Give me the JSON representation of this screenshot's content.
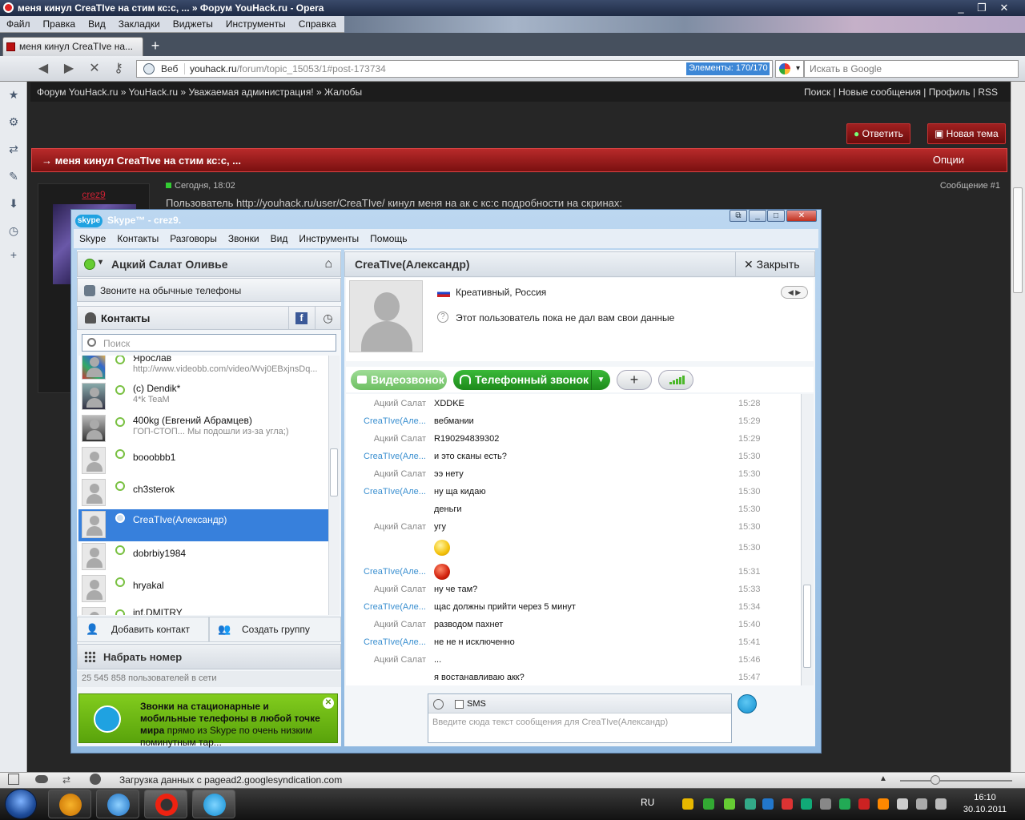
{
  "window": {
    "title": "меня кинул CreaTIve на стим кс:с, ... » Форум YouHack.ru - Opera"
  },
  "opera_menu": [
    "Файл",
    "Правка",
    "Вид",
    "Закладки",
    "Виджеты",
    "Инструменты",
    "Справка"
  ],
  "tab": {
    "label": "меня кинул CreaTIve на..."
  },
  "address": {
    "site_label": "Веб",
    "host": "youhack.ru",
    "path": "/forum/topic_15053/1#post-173734",
    "progress": "Элементы: 170/170",
    "search_placeholder": "Искать в Google"
  },
  "forum": {
    "breadcrumb": "Форум YouHack.ru » YouHack.ru » Уважаемая администрация! » Жалобы",
    "top_links": "Поиск | Новые сообщения | Профиль | RSS",
    "reply_button": "Ответить",
    "new_topic_button": "Новая тема",
    "thread_title": "→ меня кинул CreaTIve на стим кс:с, ...",
    "options": "Опции",
    "author": "crez9",
    "post_time": "Сегодня, 18:02",
    "post_number": "Сообщение #1",
    "post_text": "Пользователь http://youhack.ru/user/CreaTIve/ кинул меня на ак с кс:с подробности на скринах:"
  },
  "statusbar": {
    "text": "Загрузка данных с pagead2.googlesyndication.com"
  },
  "taskbar": {
    "lang": "RU",
    "time": "16:10",
    "date": "30.10.2011"
  },
  "skype": {
    "title": "Skype™ - crez9.",
    "menu": [
      "Skype",
      "Контакты",
      "Разговоры",
      "Звонки",
      "Вид",
      "Инструменты",
      "Помощь"
    ],
    "mood_name": "Ацкий Салат Оливье",
    "call_phones": "Звоните на обычные телефоны",
    "contacts_title": "Контакты",
    "search_placeholder": "Поиск",
    "contacts": [
      {
        "name": "Ярослав",
        "sub": "http://www.videobb.com/video/Wvj0EBxjnsDq..."
      },
      {
        "name": "(c) Dendik*",
        "sub": "4*k TeaM"
      },
      {
        "name": "400kg (Евгений Абрамцев)",
        "sub": "ГОП-СТОП... Мы подошли из-за угла;)"
      },
      {
        "name": "booobbb1",
        "sub": ""
      },
      {
        "name": "ch3sterok",
        "sub": ""
      },
      {
        "name": "CreaTIve(Александр)",
        "sub": ""
      },
      {
        "name": "dobrbiy1984",
        "sub": ""
      },
      {
        "name": "hryakal",
        "sub": ""
      },
      {
        "name": "inf.DMITRY",
        "sub": ""
      }
    ],
    "add_contact": "Добавить контакт",
    "create_group": "Создать группу",
    "dial": "Набрать номер",
    "online_count": "25 545 858 пользователей в сети",
    "promo_bold": "Звонки на стационарные и мобильные телефоны в любой точке мира",
    "promo_rest": " прямо из Skype по очень низким поминутным тар...",
    "chat_title": "CreaTIve(Александр)",
    "close": "Закрыть",
    "profile_location": "Креативный, Россия",
    "profile_note": "Этот пользователь пока не дал вам свои данные",
    "video_call": "Видеозвонок",
    "phone_call": "Телефонный звонок",
    "messages": [
      {
        "sender": "Ацкий Салат",
        "me": false,
        "text": "XDDKE",
        "time": "15:28"
      },
      {
        "sender": "CreaTIve(Але...",
        "me": true,
        "text": "вебмании",
        "time": "15:29"
      },
      {
        "sender": "Ацкий Салат",
        "me": false,
        "text": "R190294839302",
        "time": "15:29"
      },
      {
        "sender": "CreaTIve(Але...",
        "me": true,
        "text": "и это сканы есть?",
        "time": "15:30"
      },
      {
        "sender": "Ацкий Салат",
        "me": false,
        "text": "ээ нету",
        "time": "15:30"
      },
      {
        "sender": "CreaTIve(Але...",
        "me": true,
        "text": "ну ща кидаю",
        "time": "15:30"
      },
      {
        "sender": "",
        "me": true,
        "text": "деньги",
        "time": "15:30"
      },
      {
        "sender": "Ацкий Салат",
        "me": false,
        "text": "угу",
        "time": "15:30"
      },
      {
        "sender": "",
        "me": false,
        "text": "",
        "emoji": "smile",
        "time": "15:30"
      },
      {
        "sender": "CreaTIve(Але...",
        "me": true,
        "text": "",
        "emoji": "devil",
        "time": "15:31"
      },
      {
        "sender": "Ацкий Салат",
        "me": false,
        "text": "ну че там?",
        "time": "15:33"
      },
      {
        "sender": "CreaTIve(Але...",
        "me": true,
        "text": "щас должны прийти через 5 минут",
        "time": "15:34"
      },
      {
        "sender": "Ацкий Салат",
        "me": false,
        "text": "разводом пахнет",
        "time": "15:40"
      },
      {
        "sender": "CreaTIve(Але...",
        "me": true,
        "text": "не не н исключенно",
        "time": "15:41"
      },
      {
        "sender": "Ацкий Салат",
        "me": false,
        "text": "...",
        "time": "15:46"
      },
      {
        "sender": "",
        "me": false,
        "text": "я востанавливаю акк?",
        "time": "15:47"
      }
    ],
    "sms_label": "SMS",
    "input_placeholder": "Введите сюда текст сообщения для CreaTIve(Александр)"
  }
}
